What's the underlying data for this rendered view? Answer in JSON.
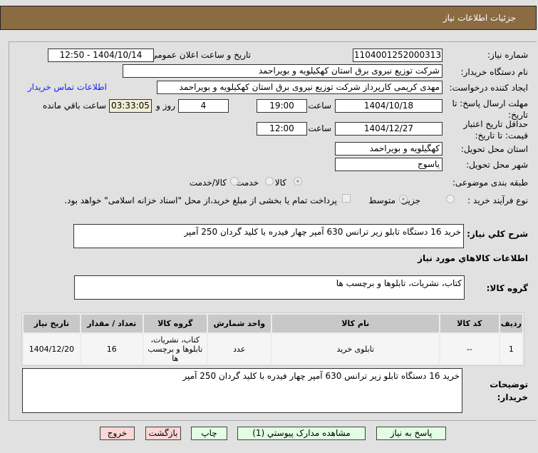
{
  "header": {
    "title": "جزئیات اطلاعات نیاز"
  },
  "form": {
    "need_number_label": "شماره نیاز:",
    "need_number": "1104001252000313",
    "announce_label": "تاریخ و ساعت اعلان عمومی:",
    "announce_value": "1404/10/14 - 12:50",
    "buyer_org_label": "نام دستگاه خریدار:",
    "buyer_org": "شرکت توزیع نیروی برق استان کهکیلویه و بویراحمد",
    "creator_label": "ایجاد کننده درخواست:",
    "creator": "مهدی کریمی کارپرداز شرکت توزیع نیروی برق استان کهکیلویه و بویراحمد",
    "contact_link": "اطلاعات تماس خریدار",
    "deadline_label": "مهلت ارسال پاسخ: تا تاریخ:",
    "deadline_date": "1404/10/18",
    "time_label": "ساعت",
    "deadline_time": "19:00",
    "days": "4",
    "days_label": "روز و",
    "remaining": "03:33:05",
    "remaining_label": "ساعت باقي مانده",
    "validity_label": "حداقل تاریخ اعتبار قیمت: تا تاریخ:",
    "validity_date": "1404/12/27",
    "validity_time": "12:00",
    "province_label": "استان محل تحویل:",
    "province": "کهگیلویه و بویراحمد",
    "city_label": "شهر محل تحویل:",
    "city": "یاسوج",
    "category_label": "طبقه بندی موضوعی:",
    "category_options": [
      "کالا",
      "خدمت",
      "کالا/خدمت"
    ],
    "process_label": "نوع فرآیند خرید :",
    "process_options": [
      "جزیی",
      "متوسط"
    ],
    "payment_note": "پرداخت تمام یا بخشی از مبلغ خرید،از محل \"اسناد خزانه اسلامی\" خواهد بود.",
    "description_label": "شرح کلي نیاز:",
    "description": "خرید 16 دستگاه تابلو زیر ترانس 630 آمپر چهار فیدره با کلید گردان 250 آمپر",
    "goods_info_title": "اطلاعات کالاهاي مورد نیاز",
    "goods_group_label": "گروه کالا:",
    "goods_group": "کتاب، نشریات، تابلوها و برچسب ها",
    "buyer_notes_label": "توضیحات خریدار:",
    "buyer_notes": "خرید 16 دستگاه تابلو زیر ترانس 630 آمپر چهار فیدره با کلید گردان 250 آمپر"
  },
  "table": {
    "headers": [
      "ردیف",
      "کد کالا",
      "نام کالا",
      "واحد شمارش",
      "گروه کالا",
      "تعداد / مقدار",
      "تاریخ نیاز"
    ],
    "rows": [
      [
        "1",
        "--",
        "تابلوی خرید",
        "عدد",
        "کتاب، نشریات، تابلوها و برچسب ها",
        "16",
        "1404/12/20"
      ]
    ]
  },
  "buttons": {
    "reply": "پاسخ به نیاز",
    "attachments": "مشاهده مدارک پیوستي (1)",
    "print": "چاپ",
    "back": "بازگشت",
    "exit": "خروج"
  }
}
